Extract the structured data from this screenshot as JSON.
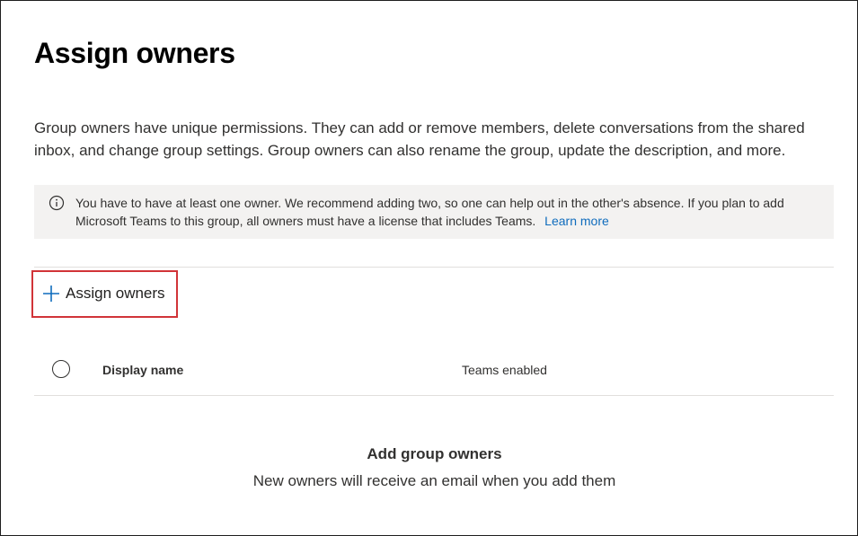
{
  "page": {
    "title": "Assign owners",
    "description": "Group owners have unique permissions. They can add or remove members, delete conversations from the shared inbox, and change group settings. Group owners can also rename the group, update the description, and more."
  },
  "info_bar": {
    "icon": "info-icon",
    "text": "You have to have at least one owner. We recommend adding two, so one can help out in the other's absence. If you plan to add Microsoft Teams to this group, all owners must have a license that includes Teams.",
    "link_label": "Learn more"
  },
  "toolbar": {
    "assign_label": "Assign owners",
    "assign_icon": "plus-icon"
  },
  "table": {
    "columns": [
      "Display name",
      "Teams enabled"
    ],
    "rows": []
  },
  "empty_state": {
    "title": "Add group owners",
    "subtitle": "New owners will receive an email when you add them"
  },
  "colors": {
    "accent": "#0f6cbd",
    "highlight_border": "#d13438",
    "info_background": "#f3f2f1"
  }
}
